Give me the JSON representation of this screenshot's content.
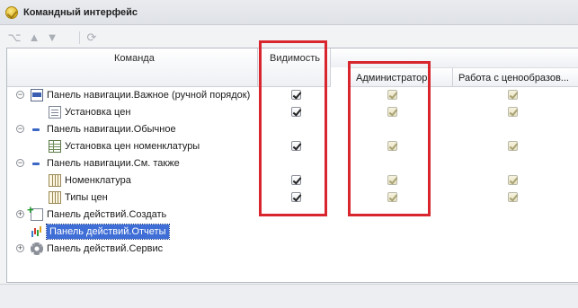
{
  "window": {
    "title": "Командный интерфейс"
  },
  "toolbar": {
    "buttons": [
      {
        "name": "tree-icon",
        "glyph": "⌥"
      },
      {
        "name": "arrow-up-icon",
        "glyph": "▲"
      },
      {
        "name": "arrow-down-icon",
        "glyph": "▼"
      },
      {
        "name": "refresh-icon",
        "glyph": "⟳"
      }
    ]
  },
  "grid": {
    "headers": {
      "command": "Команда",
      "visibility": "Видимость",
      "role_admin": "Администратор",
      "role_pricing": "Работа с ценообразов..."
    },
    "rows": [
      {
        "label": "Панель навигации.Важное (ручной порядок)",
        "toggle": "⊖",
        "icon": "navbar-icon",
        "checks": [
          true,
          true,
          true
        ]
      },
      {
        "label": "Установка цен",
        "toggle": "",
        "icon": "document-icon",
        "checks": [
          true,
          true,
          true
        ]
      },
      {
        "label": "Панель навигации.Обычное",
        "toggle": "⊖",
        "icon": "minus-icon",
        "checks": [
          false,
          false,
          false
        ]
      },
      {
        "label": "Установка цен номенклатуры",
        "toggle": "",
        "icon": "table-icon",
        "checks": [
          true,
          true,
          true
        ]
      },
      {
        "label": "Панель навигации.См. также",
        "toggle": "⊖",
        "icon": "minus-icon",
        "checks": [
          false,
          false,
          false
        ]
      },
      {
        "label": "Номенклатура",
        "toggle": "",
        "icon": "catalog-icon",
        "checks": [
          true,
          true,
          true
        ]
      },
      {
        "label": "Типы цен",
        "toggle": "",
        "icon": "catalog-icon",
        "checks": [
          true,
          true,
          true
        ]
      },
      {
        "label": "Панель действий.Создать",
        "toggle": "⊕",
        "icon": "create-icon",
        "checks": [
          false,
          false,
          false
        ]
      },
      {
        "label": "Панель действий.Отчеты",
        "toggle": "",
        "icon": "report-icon",
        "checks": [
          false,
          false,
          false
        ],
        "selected": true
      },
      {
        "label": "Панель действий.Сервис",
        "toggle": "⊕",
        "icon": "gear-icon",
        "checks": [
          false,
          false,
          false
        ]
      }
    ]
  },
  "colors": {
    "highlight": "#d8252e",
    "selection": "#3f6ed6"
  }
}
